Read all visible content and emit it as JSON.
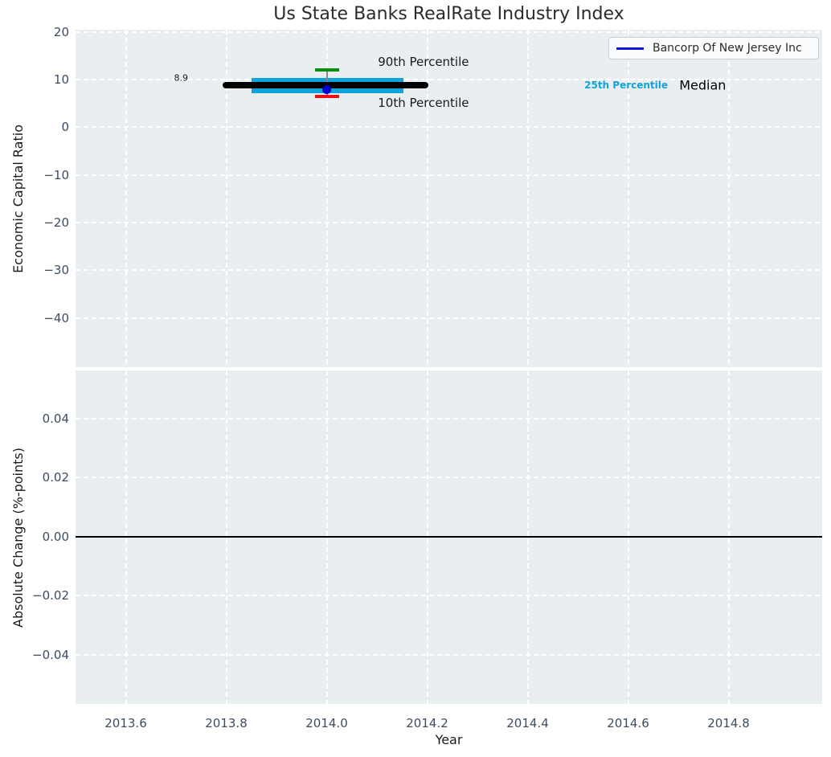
{
  "title": "Us State Banks RealRate Industry Index",
  "legend": {
    "label": "Bancorp Of New Jersey Inc",
    "line_color": "#1414dc"
  },
  "colors": {
    "plot_bg": "#e9eef0",
    "grid": "#ffffff",
    "tick_label": "#3c4c60",
    "median_line": "#000000",
    "percentile_band": "#10a2dc",
    "p90_cap": "#0a8f0a",
    "p10_cap": "#e81212",
    "whisker_stem": "#8a8a8a",
    "company_point": "#0000cd",
    "zero_line": "#000000"
  },
  "chart_data": [
    {
      "type": "line",
      "subtype": "percentile-band-timeseries",
      "ylabel": "Economic Capital Ratio",
      "xlim": [
        2013.5,
        2014.9864
      ],
      "ylim": [
        -50.3,
        20.44
      ],
      "grid": true,
      "xtick_labels_visible": false,
      "yticks": [
        {
          "value": 20,
          "label": "20"
        },
        {
          "value": 10,
          "label": "10"
        },
        {
          "value": 0,
          "label": "0"
        },
        {
          "value": -10,
          "label": "−10"
        },
        {
          "value": -20,
          "label": "−20"
        },
        {
          "value": -30,
          "label": "−30"
        },
        {
          "value": -40,
          "label": "−40"
        }
      ],
      "xticks": [
        {
          "value": 2013.6,
          "label": "2013.6"
        },
        {
          "value": 2013.8,
          "label": "2013.8"
        },
        {
          "value": 2014.0,
          "label": "2014.0"
        },
        {
          "value": 2014.2,
          "label": "2014.2"
        },
        {
          "value": 2014.4,
          "label": "2014.4"
        },
        {
          "value": 2014.6,
          "label": "2014.6"
        },
        {
          "value": 2014.8,
          "label": "2014.8"
        }
      ],
      "series": {
        "median": {
          "name": "Median",
          "value": 8.9,
          "x_start": 2013.793,
          "x_end": 2014.202
        },
        "iqr_band": {
          "name": "25th-75th Percentile band",
          "low": 7.2,
          "high": 10.3,
          "x_start": 2013.85,
          "x_end": 2014.153
        },
        "p90": {
          "name": "90th Percentile",
          "x": 2014.0,
          "value": 12.1
        },
        "p10": {
          "name": "10th Percentile",
          "x": 2014.0,
          "value": 6.4
        },
        "company_point": {
          "name": "Bancorp Of New Jersey Inc",
          "x": 2014.0,
          "value": 7.9
        }
      },
      "annotations": [
        {
          "text": "8.9",
          "x": 2013.71,
          "y": 10.3,
          "size": 11,
          "weight": "normal",
          "color": "#1a1a1a",
          "anchor": "center"
        },
        {
          "text": "90th Percentile",
          "x": 2014.102,
          "y": 13.7,
          "size": 15,
          "weight": "normal",
          "color": "#1a1a1a",
          "anchor": "left"
        },
        {
          "text": "10th Percentile",
          "x": 2014.102,
          "y": 5.1,
          "size": 15,
          "weight": "normal",
          "color": "#1a1a1a",
          "anchor": "left"
        },
        {
          "text": "25th Percentile",
          "x": 2014.513,
          "y": 8.75,
          "size": 12,
          "weight": "bold",
          "color": "#10a2dc",
          "anchor": "left"
        },
        {
          "text": "Median",
          "x": 2014.702,
          "y": 8.75,
          "size": 16,
          "weight": "normal",
          "color": "#000000",
          "anchor": "left"
        }
      ]
    },
    {
      "type": "line",
      "subtype": "zero-reference-line",
      "ylabel": "Absolute Change (%-points)",
      "xlabel": "Year",
      "xlim": [
        2013.5,
        2014.9864
      ],
      "ylim": [
        -0.0566,
        0.0563
      ],
      "grid": true,
      "xtick_labels_visible": true,
      "zero_line": 0.0,
      "yticks": [
        {
          "value": 0.04,
          "label": "0.04"
        },
        {
          "value": 0.02,
          "label": "0.02"
        },
        {
          "value": 0.0,
          "label": "0.00"
        },
        {
          "value": -0.02,
          "label": "−0.02"
        },
        {
          "value": -0.04,
          "label": "−0.04"
        }
      ],
      "xticks": [
        {
          "value": 2013.6,
          "label": "2013.6"
        },
        {
          "value": 2013.8,
          "label": "2013.8"
        },
        {
          "value": 2014.0,
          "label": "2014.0"
        },
        {
          "value": 2014.2,
          "label": "2014.2"
        },
        {
          "value": 2014.4,
          "label": "2014.4"
        },
        {
          "value": 2014.6,
          "label": "2014.6"
        },
        {
          "value": 2014.8,
          "label": "2014.8"
        }
      ]
    }
  ]
}
